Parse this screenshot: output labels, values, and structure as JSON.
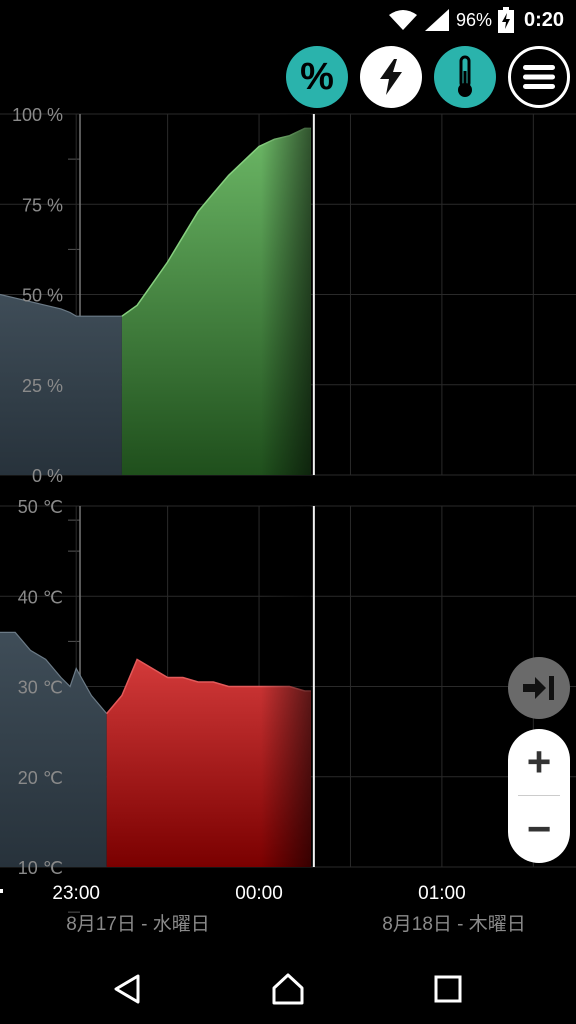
{
  "status_bar": {
    "battery_percent": "96%",
    "time": "0:20"
  },
  "toolbar": {
    "percent_label": "%",
    "buttons": [
      "percent-icon",
      "lightning-icon",
      "thermometer-icon",
      "menu-icon"
    ]
  },
  "colors": {
    "accent": "#2ab3ac",
    "charge_fill": "#4c9a46",
    "temp_fill": "#b01a1a",
    "history_fill": "#3c4a55",
    "grid": "#2a2a2a"
  },
  "x_axis": {
    "time_labels": [
      "23:00",
      "00:00",
      "01:00"
    ],
    "date_labels": [
      "8月17日 - 水曜日",
      "8月18日 - 木曜日"
    ]
  },
  "chart_data": [
    {
      "type": "area",
      "ylim": [
        0,
        100
      ],
      "ytick_labels": [
        "100 %",
        "75 %",
        "50 %",
        "25 %",
        "0 %"
      ],
      "yticks": [
        100,
        75,
        50,
        25,
        0
      ],
      "series": [
        {
          "x": [
            "22:35",
            "22:40",
            "22:45",
            "22:50",
            "22:55",
            "22:58",
            "23:00",
            "23:05",
            "23:10",
            "23:15",
            "23:20",
            "23:25",
            "23:30",
            "23:35",
            "23:40",
            "23:45",
            "23:50",
            "23:55",
            "00:00",
            "00:05",
            "00:10",
            "00:15",
            "00:17"
          ],
          "values": [
            50,
            49,
            48,
            47,
            46,
            45,
            44,
            44,
            44,
            44,
            47,
            53,
            59,
            66,
            73,
            78,
            83,
            87,
            91,
            93,
            94,
            96,
            96
          ],
          "segments": {
            "history_until_index": 9,
            "charging_from_index": 9
          }
        }
      ]
    },
    {
      "type": "area",
      "ylim": [
        10,
        50
      ],
      "ytick_labels": [
        "50 ℃",
        "40 ℃",
        "30 ℃",
        "20 ℃",
        "10 ℃"
      ],
      "yticks": [
        50,
        40,
        30,
        20,
        10
      ],
      "series": [
        {
          "x": [
            "22:35",
            "22:40",
            "22:45",
            "22:50",
            "22:55",
            "22:58",
            "23:00",
            "23:05",
            "23:10",
            "23:15",
            "23:20",
            "23:25",
            "23:30",
            "23:35",
            "23:40",
            "23:45",
            "23:50",
            "23:55",
            "00:00",
            "00:05",
            "00:10",
            "00:15",
            "00:17"
          ],
          "values": [
            36,
            36,
            34,
            33,
            31,
            30,
            32,
            29,
            27,
            29,
            33,
            32,
            31,
            31,
            30.5,
            30.5,
            30,
            30,
            30,
            30,
            30,
            29.5,
            29.5
          ],
          "segments": {
            "history_until_index": 8,
            "charging_from_index": 8
          }
        }
      ]
    }
  ],
  "now_time": "00:17",
  "x_range": [
    "22:35",
    "01:44"
  ],
  "nav": [
    "back-icon",
    "home-icon",
    "recents-icon"
  ],
  "zoom": {
    "plus": "+",
    "minus": "−"
  }
}
